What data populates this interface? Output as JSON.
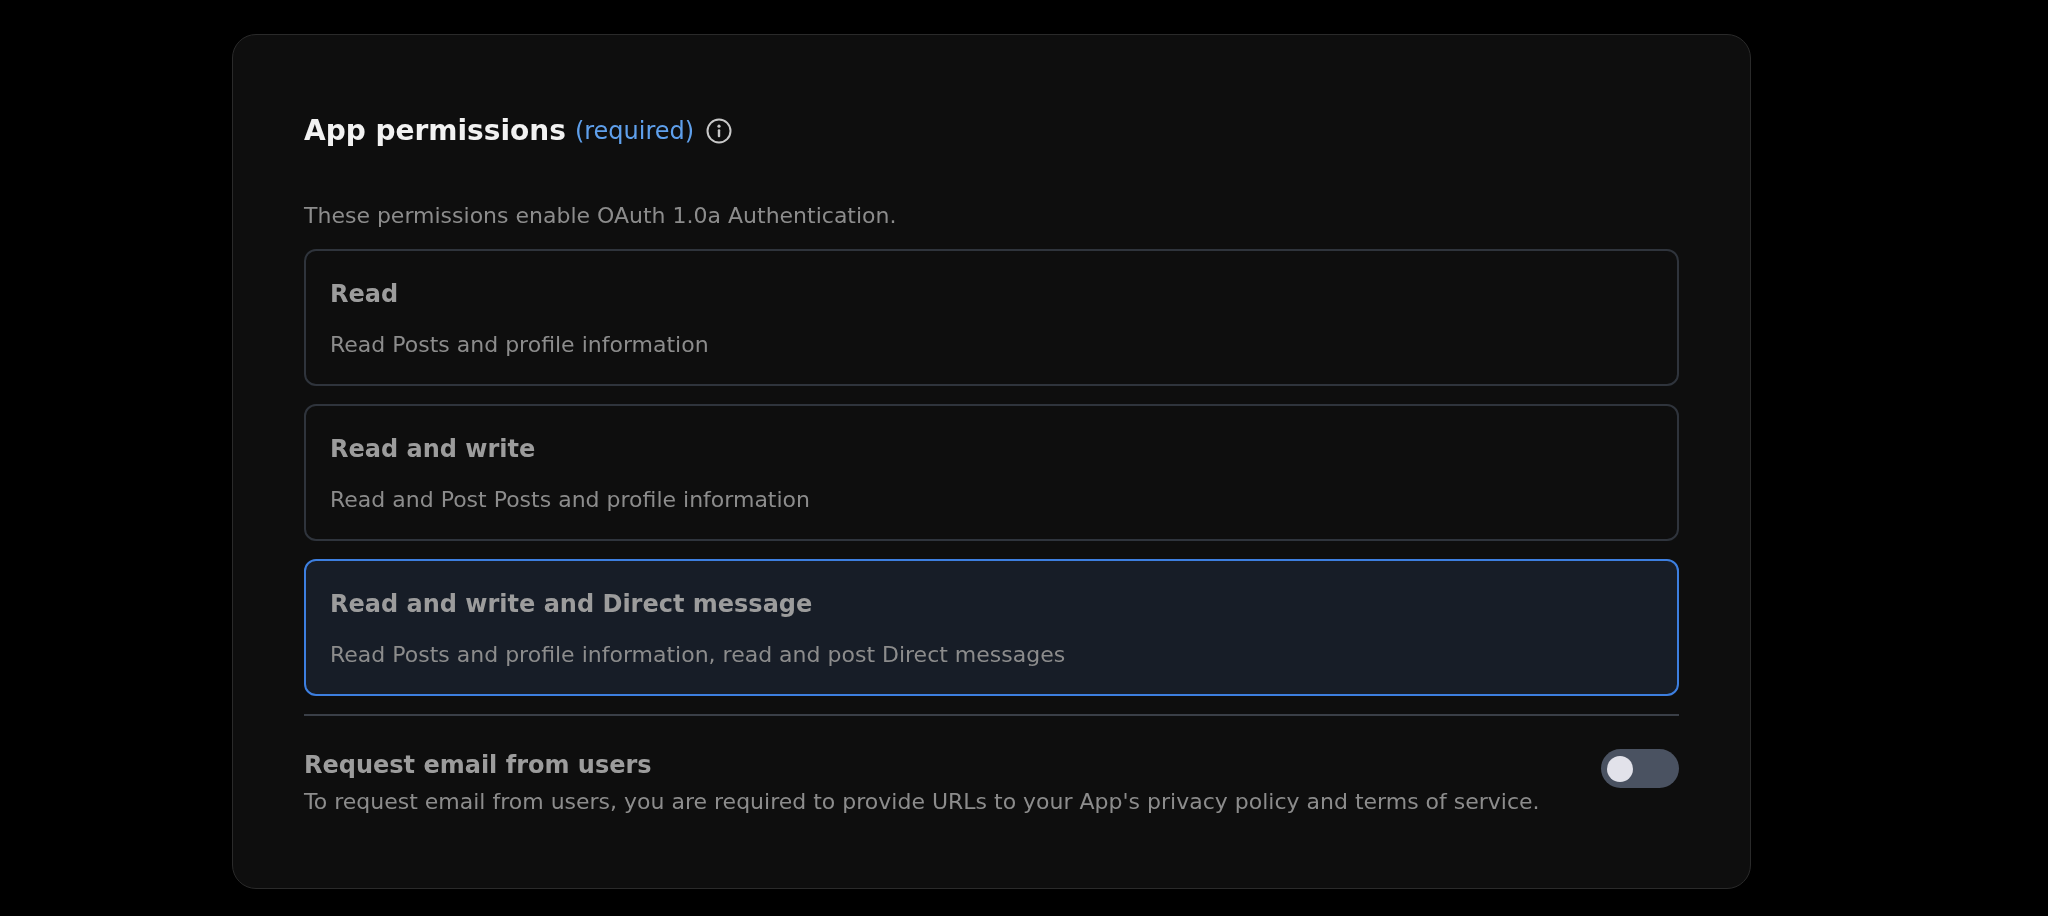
{
  "section": {
    "title": "App permissions",
    "required_note": "(required)",
    "description": "These permissions enable OAuth 1.0a Authentication."
  },
  "permissions": [
    {
      "label": "Read",
      "description": "Read Posts and profile information",
      "selected": false
    },
    {
      "label": "Read and write",
      "description": "Read and Post Posts and profile information",
      "selected": false
    },
    {
      "label": "Read and write and Direct message",
      "description": "Read Posts and profile information, read and post Direct messages",
      "selected": true
    }
  ],
  "email_request": {
    "label": "Request email from users",
    "description": "To request email from users, you are required to provide URLs to your App's privacy policy and terms of service.",
    "on": false
  }
}
